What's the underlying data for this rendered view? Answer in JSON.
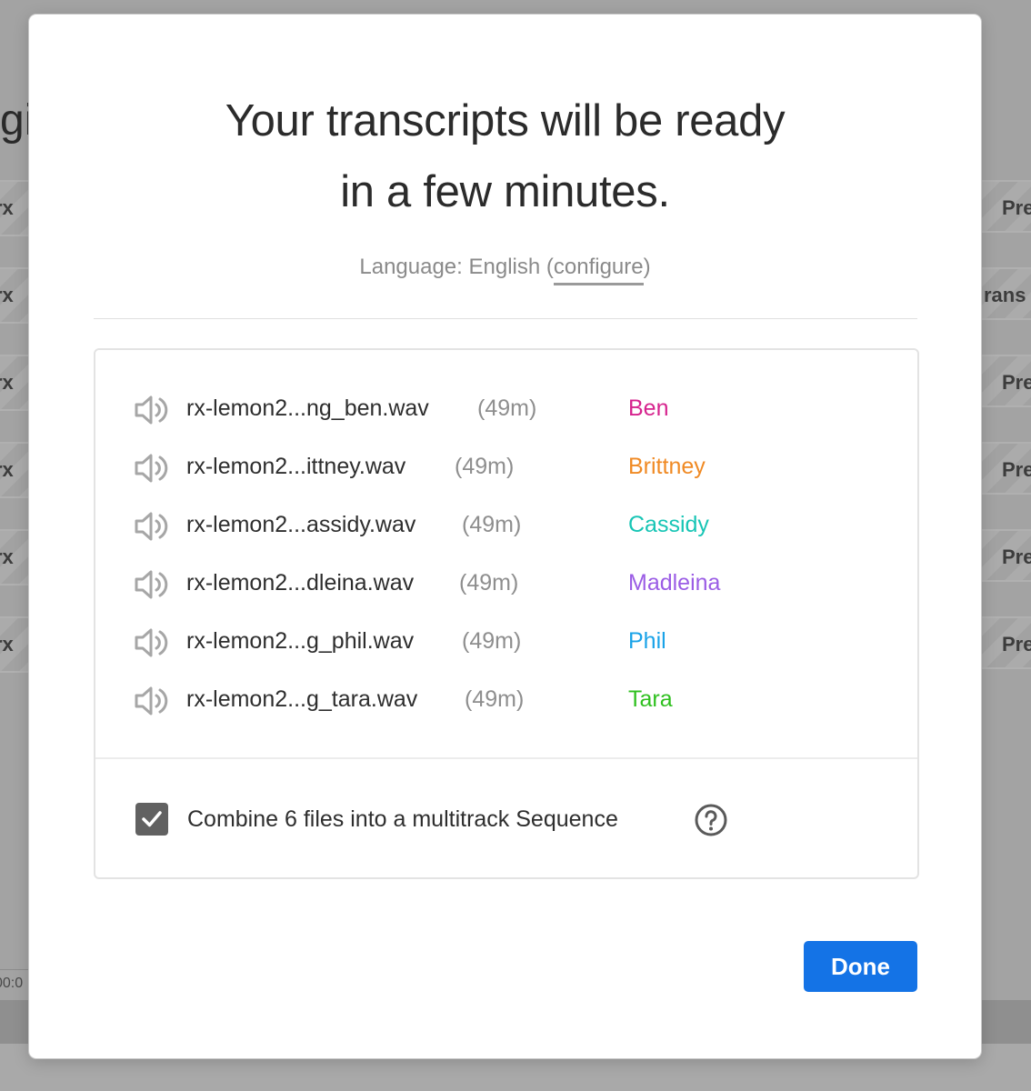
{
  "background": {
    "heading_fragment": "gi",
    "left_row_fragment": "rx",
    "right_row_labels": [
      "Pre",
      "rans",
      "Pre",
      "Pre",
      "Pre",
      "Pre"
    ],
    "timecode_fragment": "00:0"
  },
  "modal": {
    "title_line1": "Your transcripts will be ready",
    "title_line2": "in a few minutes.",
    "language_prefix": "Language: English (",
    "configure_label": "configure",
    "language_suffix": ")",
    "files": [
      {
        "name": "rx-lemon2...ng_ben.wav",
        "duration": "(49m)",
        "speaker": "Ben",
        "color": "#d6248e",
        "icon": "speaker-icon"
      },
      {
        "name": "rx-lemon2...ittney.wav",
        "duration": "(49m)",
        "speaker": "Brittney",
        "color": "#f08a24",
        "icon": "speaker-icon"
      },
      {
        "name": "rx-lemon2...assidy.wav",
        "duration": "(49m)",
        "speaker": "Cassidy",
        "color": "#17c5b5",
        "icon": "speaker-icon"
      },
      {
        "name": "rx-lemon2...dleina.wav",
        "duration": "(49m)",
        "speaker": "Madleina",
        "color": "#9b5de5",
        "icon": "speaker-icon"
      },
      {
        "name": "rx-lemon2...g_phil.wav",
        "duration": "(49m)",
        "speaker": "Phil",
        "color": "#1aa3e8",
        "icon": "speaker-icon"
      },
      {
        "name": "rx-lemon2...g_tara.wav",
        "duration": "(49m)",
        "speaker": "Tara",
        "color": "#2fc01f",
        "icon": "speaker-icon"
      }
    ],
    "combine_checked": true,
    "combine_label": "Combine 6 files into a multitrack Sequence",
    "help_icon": "question-icon",
    "done_label": "Done",
    "accent_color": "#1473e6"
  }
}
